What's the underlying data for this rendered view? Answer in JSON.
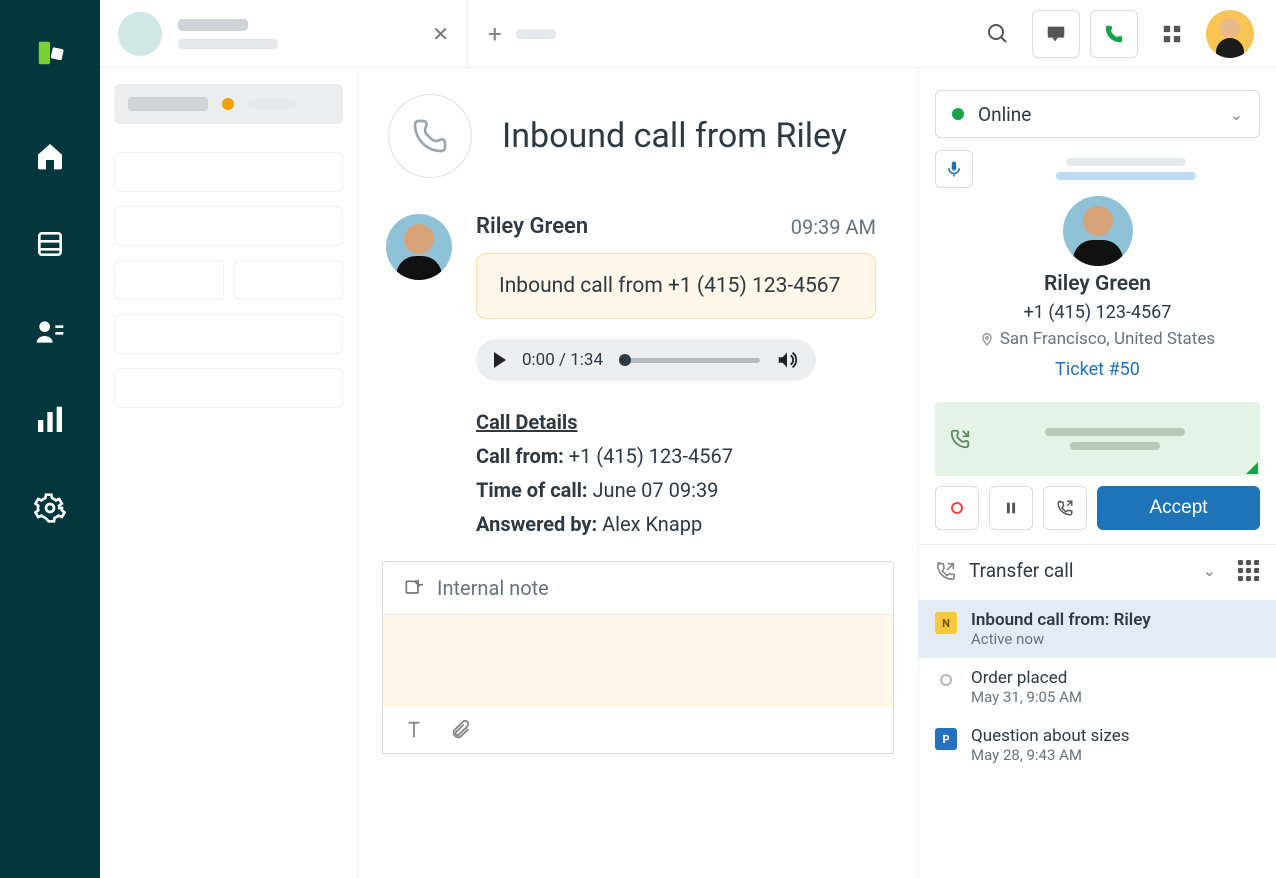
{
  "status": {
    "label": "Online"
  },
  "conversation": {
    "title": "Inbound call from Riley",
    "sender": "Riley Green",
    "time": "09:39 AM",
    "bubble": "Inbound call from +1 (415) 123-4567",
    "audio": {
      "current": "0:00",
      "total": "1:34",
      "display": "0:00 / 1:34"
    },
    "details_hdr": "Call Details",
    "call_from_lbl": "Call from:",
    "call_from_val": " +1 (415) 123-4567",
    "time_of_lbl": "Time of call:",
    "time_of_val": " June 07 09:39",
    "answered_lbl": "Answered by:",
    "answered_val": " Alex Knapp"
  },
  "composer": {
    "tab": "Internal note"
  },
  "caller": {
    "name": "Riley Green",
    "phone": "+1 (415) 123-4567",
    "location": "San Francisco, United States",
    "ticket": "Ticket #50"
  },
  "call_actions": {
    "accept": "Accept",
    "transfer": "Transfer call"
  },
  "timeline": {
    "t1_title": "Inbound call from: Riley",
    "t1_sub": "Active now",
    "t2_title": "Order placed",
    "t2_sub": "May 31, 9:05 AM",
    "t3_title": "Question about sizes",
    "t3_sub": "May 28, 9:43 AM"
  }
}
